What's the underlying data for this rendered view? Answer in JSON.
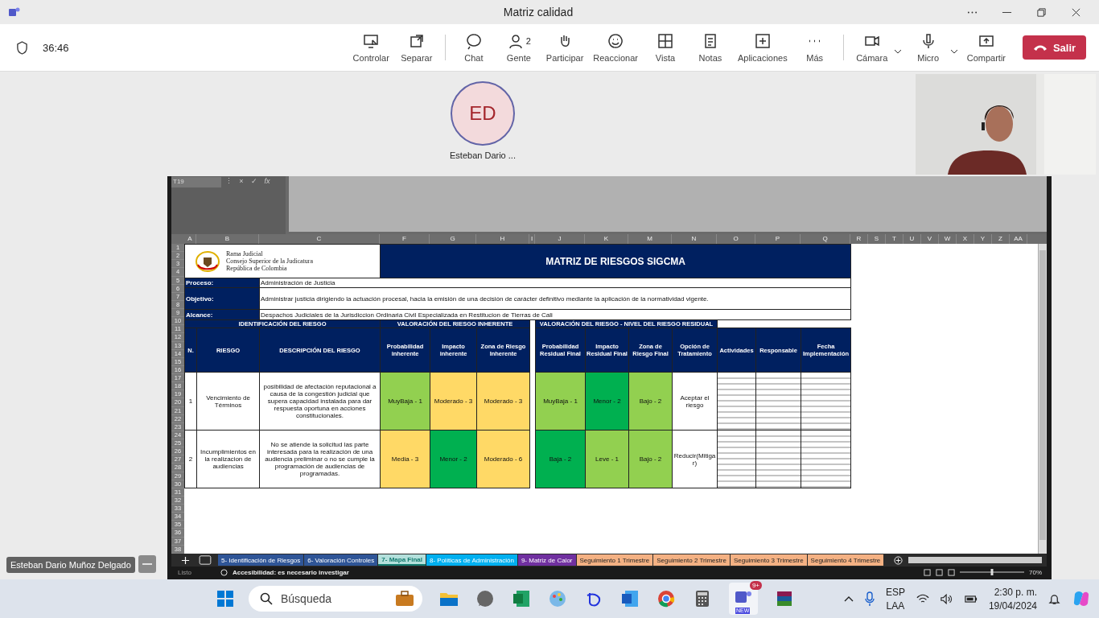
{
  "window": {
    "title": "Matriz calidad",
    "timer": "36:46"
  },
  "toolbar": [
    {
      "label": "Controlar"
    },
    {
      "label": "Separar"
    },
    {
      "label": "Chat"
    },
    {
      "label": "Gente",
      "count": "2"
    },
    {
      "label": "Participar"
    },
    {
      "label": "Reaccionar"
    },
    {
      "label": "Vista"
    },
    {
      "label": "Notas"
    },
    {
      "label": "Aplicaciones"
    },
    {
      "label": "Más"
    },
    {
      "label": "Cámara"
    },
    {
      "label": "Micro"
    },
    {
      "label": "Compartir"
    }
  ],
  "leave_button": "Salir",
  "participant": {
    "initials": "ED",
    "name": "Esteban Dario ..."
  },
  "presenter_label": "Esteban Dario Muñoz Delgado",
  "excel": {
    "name_box": "T19",
    "menu_glyph": "⋮",
    "cancel_glyph": "×",
    "enter_glyph": "✓",
    "fx": "fx",
    "columns": [
      "A",
      "B",
      "C",
      "F",
      "G",
      "H",
      "I",
      "J",
      "K",
      "M",
      "N",
      "O",
      "P",
      "Q",
      "R",
      "S",
      "T",
      "U",
      "V",
      "W",
      "X",
      "Y",
      "Z",
      "AA"
    ],
    "rows": [
      "1",
      "2",
      "3",
      "4",
      "5",
      "6",
      "7",
      "8",
      "9",
      "10",
      "11",
      "12",
      "13",
      "14",
      "15",
      "16",
      "17",
      "18",
      "19",
      "20",
      "21",
      "22",
      "23",
      "24",
      "25",
      "26",
      "27",
      "28",
      "29",
      "30",
      "31",
      "32",
      "33",
      "34",
      "35",
      "36",
      "37",
      "38"
    ],
    "logo_lines": [
      "Rama Judicial",
      "Consejo Superior de la Judicatura",
      "República de Colombia"
    ],
    "title": "MATRIZ DE RIESGOS SIGCMA",
    "info": [
      {
        "label": "Proceso:",
        "value": "Administración de Justicia"
      },
      {
        "label": "Objetivo:",
        "value": "Administrar justicia dirigiendo la actuación procesal, hacia la emisión de una decisión de carácter definitivo mediante la aplicación de la normatividad vigente."
      },
      {
        "label": "Alcance:",
        "value": "Despachos Judiciales de la Jurisdiccion Ordinaria Civil Especializada en Restitucion de Tierras de Cali"
      }
    ],
    "sections": [
      "IDENTIFICACIÓN DEL RIESGO",
      "VALORACIÓN DEL RIESGO INHERENTE",
      "VALORACIÓN DEL RIESGO - NIVEL DEL RIESGO RESIDUAL"
    ],
    "headers": [
      "N.",
      "RIESGO",
      "DESCRIPCIÓN DEL RIESGO",
      "Probabilidad inherente",
      "Impacto inherente",
      "Zona de Riesgo Inherente",
      "Probabilidad Residual Final",
      "Impacto Residual Final",
      "Zona de Riesgo Final",
      "Opción de Tratamiento",
      "Actividades",
      "Responsable",
      "Fecha Implementación"
    ],
    "risks": [
      {
        "n": "1",
        "riesgo": "Vencimiento de Términos",
        "descripcion": "posibilidad de afectación reputacional a causa de la congestión judicial que supera capacidad instalada para dar respuesta oportuna en acciones constitucionales.",
        "inherent": [
          {
            "text": "MuyBaja - 1",
            "color": "#92d050"
          },
          {
            "text": "Moderado - 3",
            "color": "#ffd966"
          },
          {
            "text": "Moderado - 3",
            "color": "#ffd966"
          }
        ],
        "residual": [
          {
            "text": "MuyBaja - 1",
            "color": "#92d050"
          },
          {
            "text": "Menor - 2",
            "color": "#00b050"
          },
          {
            "text": "Bajo - 2",
            "color": "#92d050"
          }
        ],
        "tratamiento": "Aceptar el riesgo"
      },
      {
        "n": "2",
        "riesgo": "Incumplimientos en la realizacion de audiencias",
        "descripcion": "No se atiende la solicitud las parte interesada para la realización de una audiencia preliminar o no se cumple la programación de audiencias de programadas.",
        "inherent": [
          {
            "text": "Media - 3",
            "color": "#ffd966"
          },
          {
            "text": "Menor - 2",
            "color": "#00b050"
          },
          {
            "text": "Moderado - 6",
            "color": "#ffd966"
          }
        ],
        "residual": [
          {
            "text": "Baja - 2",
            "color": "#00b050"
          },
          {
            "text": "Leve - 1",
            "color": "#92d050"
          },
          {
            "text": "Bajo - 2",
            "color": "#92d050"
          }
        ],
        "tratamiento": "Reducir(Mitigar)"
      }
    ],
    "sheet_tabs": [
      {
        "label": "5- Identificación de Riesgos",
        "color": "#2f5597",
        "selected": false
      },
      {
        "label": "6- Valoración Controles",
        "color": "#2f5597",
        "selected": false
      },
      {
        "label": "7- Mapa Final",
        "color": "#b4e0dc",
        "selected": true
      },
      {
        "label": "8- Políticas de Administración",
        "color": "#00b0f0",
        "selected": false
      },
      {
        "label": "9- Matriz de Calor",
        "color": "#7030a0",
        "selected": false
      },
      {
        "label": "Seguimiento 1 Trimestre",
        "color": "#f4b183",
        "selected": false
      },
      {
        "label": "Seguimiento 2 Trimestre",
        "color": "#f4b183",
        "selected": false
      },
      {
        "label": "Seguimiento 3 Trimestre",
        "color": "#f4b183",
        "selected": false
      },
      {
        "label": "Seguimiento 4 Trimestre",
        "color": "#f4b183",
        "selected": false
      }
    ],
    "status_ready": "Listo",
    "accessibility": "Accesibilidad: es necesario investigar",
    "zoom": "70%",
    "zoom_slider": {
      "level": 0.5
    }
  },
  "taskbar": {
    "search_placeholder": "Búsqueda",
    "badge": "9+",
    "badge_sub": "NEW",
    "lang": "ESP",
    "layout": "LAA",
    "time": "2:30 p. m.",
    "date": "19/04/2024"
  }
}
